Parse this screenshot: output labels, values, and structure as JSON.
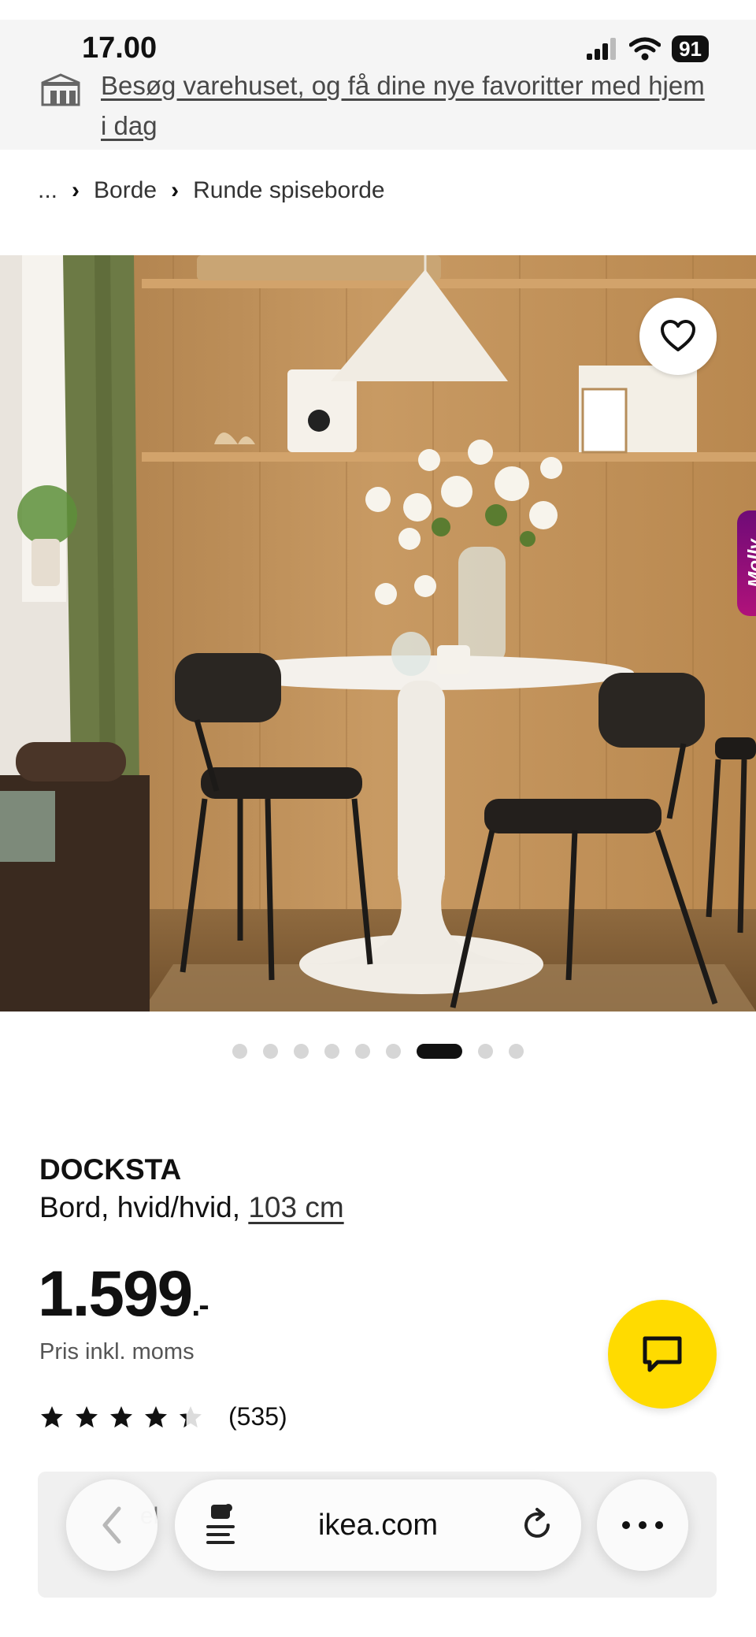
{
  "status_bar": {
    "time": "17.00",
    "battery": "91"
  },
  "banner": {
    "text": "Besøg varehuset, og få dine nye favoritter med hjem i dag"
  },
  "breadcrumb": {
    "ellipsis": "...",
    "items": [
      "Borde",
      "Runde spiseborde"
    ]
  },
  "hero": {
    "tab_label": "Molly",
    "carousel_count": 9,
    "carousel_active_index": 6
  },
  "product": {
    "name": "DOCKSTA",
    "description": "Bord, hvid/hvid, ",
    "size": "103 cm",
    "price": "1.599",
    "price_suffix": ".-",
    "price_note": "Pris inkl. moms",
    "rating": 4.3,
    "review_count": "(535)"
  },
  "stock_card": {
    "label": "el"
  },
  "browser": {
    "url": "ikea.com"
  },
  "colors": {
    "accent_yellow": "#ffdb00",
    "molly_purple": "#8a0f78"
  }
}
